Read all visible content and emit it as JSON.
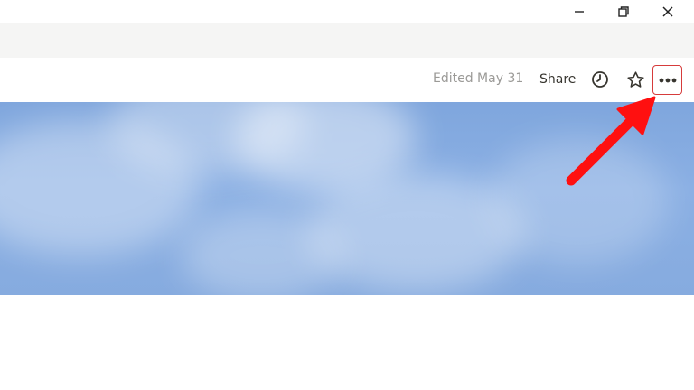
{
  "window_controls": {
    "minimize_icon": "minimize-icon",
    "restore_icon": "restore-icon",
    "close_icon": "close-icon"
  },
  "header": {
    "edited_label": "Edited May 31",
    "share_label": "Share",
    "history_icon": "clock-icon",
    "favorite_icon": "star-outline-icon",
    "more_icon": "more-dots-icon"
  },
  "cover": {
    "description_icon": "sky-cover-image"
  },
  "annotation": {
    "arrow_color": "#ff1010",
    "highlight_color": "#d63b3b"
  }
}
